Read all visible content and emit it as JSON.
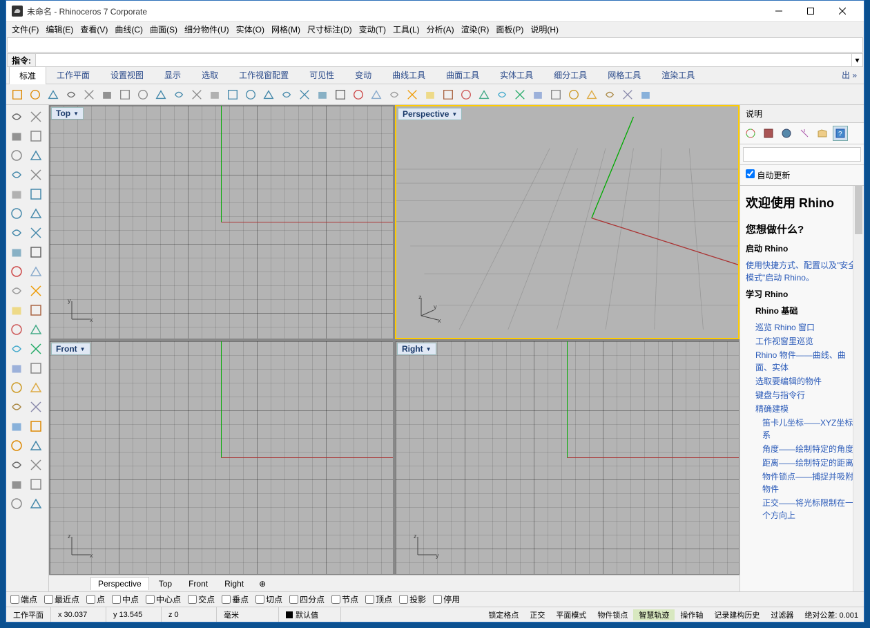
{
  "title": "未命名 - Rhinoceros 7 Corporate",
  "menu": [
    "文件(F)",
    "编辑(E)",
    "查看(V)",
    "曲线(C)",
    "曲面(S)",
    "细分物件(U)",
    "实体(O)",
    "网格(M)",
    "尺寸标注(D)",
    "变动(T)",
    "工具(L)",
    "分析(A)",
    "渲染(R)",
    "面板(P)",
    "说明(H)"
  ],
  "command_label": "指令:",
  "command_value": "",
  "ribbon_tabs": [
    "标准",
    "工作平面",
    "设置视图",
    "显示",
    "选取",
    "工作视窗配置",
    "可见性",
    "变动",
    "曲线工具",
    "曲面工具",
    "实体工具",
    "细分工具",
    "网格工具",
    "渲染工具"
  ],
  "ribbon_overflow": "出 »",
  "toolbar_icons": [
    "new-icon",
    "open-icon",
    "save-icon",
    "print-icon",
    "clipboard-icon",
    "scissors-icon",
    "copy-icon",
    "paste-icon",
    "undo-icon",
    "redo-icon",
    "pan-icon",
    "rotate-view-icon",
    "zoom-icon",
    "zoom-window-icon",
    "zoom-extents-icon",
    "zoom-selected-icon",
    "undo-view-icon",
    "redo-view-icon",
    "four-view-icon",
    "car-icon",
    "plane-icon",
    "measure-icon",
    "sun-icon",
    "light-icon",
    "shade-icon",
    "render-icon",
    "material-icon",
    "layers-icon",
    "earth-icon",
    "sphere-icon",
    "cylinder-icon",
    "options-icon",
    "gear-icon",
    "toolbox-icon",
    "properties-icon",
    "help-icon"
  ],
  "left_icons": [
    "pointer-icon",
    "lasso-icon",
    "polyline-icon",
    "move-icon",
    "circle-icon",
    "circle3pt-icon",
    "line-icon",
    "duplicate-icon",
    "arc-icon",
    "arc3pt-icon",
    "rect-icon",
    "polygon-icon",
    "curve-icon",
    "interpcrv-icon",
    "surface-icon",
    "srfpt-icon",
    "box-icon",
    "sphere2-icon",
    "cylinder2-icon",
    "tube-icon",
    "extrude-icon",
    "boolean-icon",
    "revolve-icon",
    "pipe-icon",
    "mesh-icon",
    "subd-icon",
    "text-icon",
    "dim-icon",
    "hatch-icon",
    "block-icon",
    "point-icon",
    "pointcloud-icon",
    "explode-icon",
    "join-icon",
    "trim-icon",
    "split-icon",
    "array-icon",
    "array2-icon",
    "fillet-icon",
    "chamfer-icon",
    "brush-icon",
    "eraser-icon"
  ],
  "viewports": {
    "top": "Top",
    "perspective": "Perspective",
    "front": "Front",
    "right": "Right"
  },
  "view_tabs": [
    "Perspective",
    "Top",
    "Front",
    "Right"
  ],
  "sidepanel": {
    "title": "说明",
    "auto_update": "自动更新",
    "search_placeholder": "",
    "h2a": "欢迎使用 Rhino",
    "h3a": "您想做什么?",
    "start": "启动 Rhino",
    "start_link": "使用快捷方式、配置以及\"安全模式\"启动 Rhino。",
    "learn": "学习 Rhino",
    "basics": "Rhino 基础",
    "links1": [
      "巡览 Rhino 窗口",
      "工作视窗里巡览",
      "Rhino 物件——曲线、曲面、实体",
      "选取要编辑的物件",
      "键盘与指令行",
      "精确建模"
    ],
    "links2": [
      "笛卡儿坐标——XYZ坐标系",
      "角度——绘制特定的角度",
      "距离——绘制特定的距离",
      "物件锁点——捕捉并吸附物件",
      "正交——将光标限制在一个方向上"
    ]
  },
  "osnaps": [
    "端点",
    "最近点",
    "点",
    "中点",
    "中心点",
    "交点",
    "垂点",
    "切点",
    "四分点",
    "节点",
    "顶点",
    "投影",
    "停用"
  ],
  "status": {
    "cplane": "工作平面",
    "x": "x 30.037",
    "y": "y 13.545",
    "z": "z 0",
    "units": "毫米",
    "layer": "默认值",
    "toggles": [
      "锁定格点",
      "正交",
      "平面模式",
      "物件锁点",
      "智慧轨迹",
      "操作轴",
      "记录建构历史",
      "过滤器"
    ],
    "tol": "绝对公差: 0.001"
  }
}
